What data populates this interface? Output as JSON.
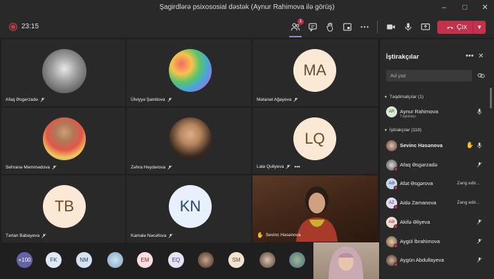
{
  "window": {
    "title": "Şagirdlərə psixososial dəstək (Aynur Rahimova ilə görüş)"
  },
  "meeting": {
    "timer": "23:15",
    "participants_badge": "1",
    "leave_label": "Çıx"
  },
  "tiles": [
    {
      "name": "Afaq Əsgərzadə",
      "kind": "photo"
    },
    {
      "name": "Ülviyyə Şamilova",
      "kind": "photo"
    },
    {
      "name": "Mətanət Ağayeva",
      "kind": "initials",
      "initials": "MA"
    },
    {
      "name": "Sehranə Məmmədova",
      "kind": "photo"
    },
    {
      "name": "Zəhra Heydərova",
      "kind": "photo"
    },
    {
      "name": "Lalə Quliyeva",
      "kind": "initials",
      "initials": "LQ"
    },
    {
      "name": "Tərlan Babayeva",
      "kind": "initials",
      "initials": "TB"
    },
    {
      "name": "Kamalə Nəcəfova",
      "kind": "initials",
      "initials": "KN"
    },
    {
      "name": "Sevinc Həsənova",
      "kind": "video"
    }
  ],
  "strip": [
    "+100",
    "FK",
    "NM",
    "",
    "EM",
    "EQ",
    "",
    "SM",
    "",
    ""
  ],
  "panel": {
    "title": "İştirakçılar",
    "search_placeholder": "Ad yaz",
    "presenters_header": "Təqdimatçılar (1)",
    "attendees_header": "İştirakçılar (118)",
    "presenters": [
      {
        "name": "Aynur Rahimova",
        "role": "Təşkilatçı",
        "initials": "AR"
      }
    ],
    "attendees": [
      {
        "name": "Sevinc Həsənova",
        "status": "",
        "initials": ""
      },
      {
        "name": "Afaq Əsgərzadə",
        "status": "",
        "initials": ""
      },
      {
        "name": "Afət Əsgərova",
        "status": "Zəng edir...",
        "initials": "AƏ"
      },
      {
        "name": "Aidə Zamanova",
        "status": "Zəng edir...",
        "initials": "AZ"
      },
      {
        "name": "Akifə Əliyeva",
        "status": "",
        "initials": "AƏ"
      },
      {
        "name": "Aygül İbrahimova",
        "status": "",
        "initials": ""
      },
      {
        "name": "Aygün Abdullayeva",
        "status": "",
        "initials": ""
      }
    ]
  },
  "colors": {
    "accent": "#8b8cc7",
    "leave": "#c4314b",
    "background": "#1f1f1f",
    "tile": "#292929"
  }
}
